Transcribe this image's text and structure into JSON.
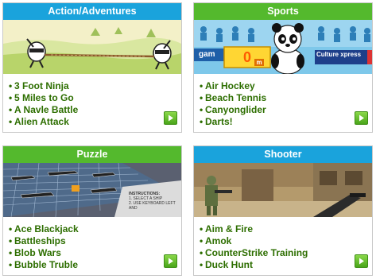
{
  "colors": {
    "header_blue": "#1aa3dc",
    "header_green": "#54b92d",
    "link_green": "#2d6e00",
    "play_green": "#5cb82a"
  },
  "cards": [
    {
      "title": "Action/Adventures",
      "games": [
        "3 Foot Ninja",
        "5 Miles to Go",
        "A Navle Battle",
        "Alien Attack"
      ],
      "icon": "play-icon"
    },
    {
      "title": "Sports",
      "games": [
        "Air Hockey",
        "Beach Tennis",
        "Canyonglider",
        "Darts!"
      ],
      "score_value": "0",
      "score_unit": "m",
      "banner_left": "gam",
      "banner_right": "Culture xpress",
      "icon": "play-icon"
    },
    {
      "title": "Puzzle",
      "games": [
        "Ace Blackjack",
        "Battleships",
        "Blob Wars",
        "Bubble Truble"
      ],
      "instructions": [
        "INSTRUCTIONS:",
        "1. SELECT A SHIP",
        "2. USE KEYBOARD LEFT AND"
      ],
      "icon": "play-icon"
    },
    {
      "title": "Shooter",
      "games": [
        "Aim & Fire",
        "Amok",
        "CounterStrike Training",
        "Duck Hunt"
      ],
      "icon": "play-icon"
    }
  ]
}
